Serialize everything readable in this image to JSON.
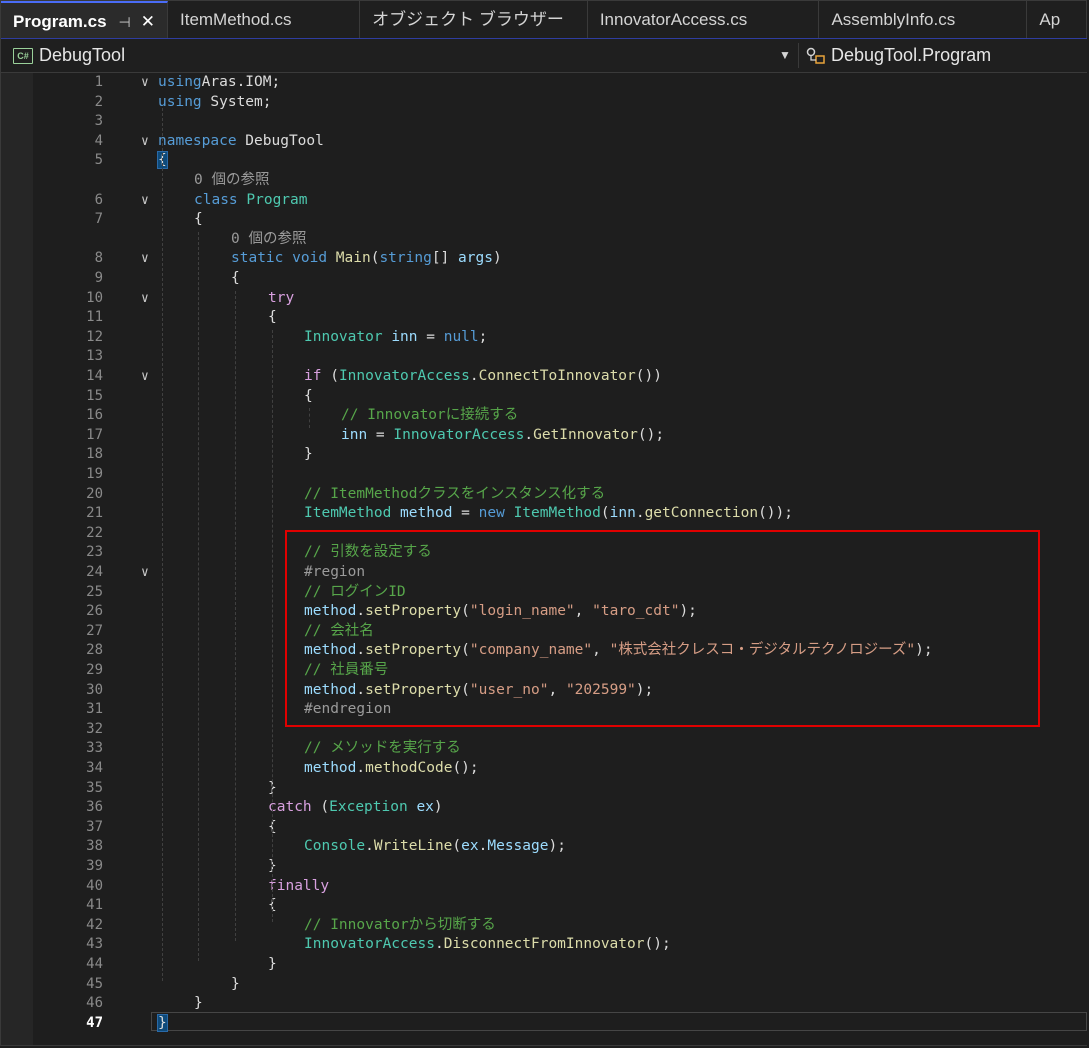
{
  "tabs": [
    {
      "label": "Program.cs",
      "active": true
    },
    {
      "label": "ItemMethod.cs",
      "active": false
    },
    {
      "label": "オブジェクト ブラウザー",
      "active": false
    },
    {
      "label": "InnovatorAccess.cs",
      "active": false
    },
    {
      "label": "AssemblyInfo.cs",
      "active": false
    },
    {
      "label": "Ap",
      "active": false
    }
  ],
  "navbar": {
    "project": "DebugTool",
    "project_badge": "C#",
    "class_path": "DebugTool.Program"
  },
  "icons": {
    "pin": "pin-icon",
    "close": "close-icon",
    "dropdown": "chevron-down-icon",
    "class": "class-icon",
    "fold": "fold-chevron-icon"
  },
  "colors": {
    "keyword": "#569cd6",
    "type": "#4ec9b0",
    "method": "#dcdcaa",
    "string": "#d69d85",
    "comment": "#57a64a",
    "highlight_box": "#e00000"
  },
  "code": {
    "highlighted_lines": "23-31",
    "current_line": 47,
    "lines": [
      {
        "n": 1,
        "fold": true,
        "indent": 0,
        "tokens": [
          [
            "kw",
            "using"
          ],
          [
            "",
            "Aras.IOM;"
          ]
        ]
      },
      {
        "n": 2,
        "fold": false,
        "indent": 0,
        "tokens": [
          [
            "kw",
            "using"
          ],
          [
            "",
            " System;"
          ]
        ]
      },
      {
        "n": 3,
        "fold": false,
        "indent": 0,
        "tokens": []
      },
      {
        "n": 4,
        "fold": true,
        "indent": 0,
        "tokens": [
          [
            "kw",
            "namespace"
          ],
          [
            "",
            " DebugTool"
          ]
        ]
      },
      {
        "n": 5,
        "fold": false,
        "indent": 0,
        "tokens": [
          [
            "brace",
            "{"
          ]
        ]
      },
      {
        "n": null,
        "ref": true,
        "indent": 1,
        "tokens": [
          [
            "ref",
            "0 個の参照"
          ]
        ]
      },
      {
        "n": 6,
        "fold": true,
        "indent": 1,
        "tokens": [
          [
            "kw",
            "class"
          ],
          [
            "",
            " "
          ],
          [
            "ty",
            "Program"
          ]
        ]
      },
      {
        "n": 7,
        "fold": false,
        "indent": 1,
        "tokens": [
          [
            "",
            "{"
          ]
        ]
      },
      {
        "n": null,
        "ref": true,
        "indent": 2,
        "tokens": [
          [
            "ref",
            "0 個の参照"
          ]
        ]
      },
      {
        "n": 8,
        "fold": true,
        "indent": 2,
        "tokens": [
          [
            "kw",
            "static"
          ],
          [
            "",
            " "
          ],
          [
            "kw",
            "void"
          ],
          [
            "",
            " "
          ],
          [
            "fn",
            "Main"
          ],
          [
            "",
            "("
          ],
          [
            "kw",
            "string"
          ],
          [
            "",
            "[] "
          ],
          [
            "var",
            "args"
          ],
          [
            "",
            ")"
          ]
        ]
      },
      {
        "n": 9,
        "fold": false,
        "indent": 2,
        "tokens": [
          [
            "",
            "{"
          ]
        ]
      },
      {
        "n": 10,
        "fold": true,
        "indent": 3,
        "tokens": [
          [
            "ctl",
            "try"
          ]
        ]
      },
      {
        "n": 11,
        "fold": false,
        "indent": 3,
        "tokens": [
          [
            "",
            "{"
          ]
        ]
      },
      {
        "n": 12,
        "fold": false,
        "indent": 4,
        "tokens": [
          [
            "ty",
            "Innovator"
          ],
          [
            "",
            " "
          ],
          [
            "var",
            "inn"
          ],
          [
            "",
            " = "
          ],
          [
            "kw",
            "null"
          ],
          [
            "",
            ";"
          ]
        ]
      },
      {
        "n": 13,
        "fold": false,
        "indent": 4,
        "tokens": []
      },
      {
        "n": 14,
        "fold": true,
        "indent": 4,
        "tokens": [
          [
            "ctl",
            "if"
          ],
          [
            "",
            " ("
          ],
          [
            "ty",
            "InnovatorAccess"
          ],
          [
            "",
            "."
          ],
          [
            "fn",
            "ConnectToInnovator"
          ],
          [
            "",
            "())"
          ]
        ]
      },
      {
        "n": 15,
        "fold": false,
        "indent": 4,
        "tokens": [
          [
            "",
            "{"
          ]
        ]
      },
      {
        "n": 16,
        "fold": false,
        "indent": 5,
        "tokens": [
          [
            "cm",
            "// Innovatorに接続する"
          ]
        ]
      },
      {
        "n": 17,
        "fold": false,
        "indent": 5,
        "tokens": [
          [
            "var",
            "inn"
          ],
          [
            "",
            " = "
          ],
          [
            "ty",
            "InnovatorAccess"
          ],
          [
            "",
            "."
          ],
          [
            "fn",
            "GetInnovator"
          ],
          [
            "",
            "();"
          ]
        ]
      },
      {
        "n": 18,
        "fold": false,
        "indent": 4,
        "tokens": [
          [
            "",
            "}"
          ]
        ]
      },
      {
        "n": 19,
        "fold": false,
        "indent": 4,
        "tokens": []
      },
      {
        "n": 20,
        "fold": false,
        "indent": 4,
        "tokens": [
          [
            "cm",
            "// ItemMethodクラスをインスタンス化する"
          ]
        ]
      },
      {
        "n": 21,
        "fold": false,
        "indent": 4,
        "tokens": [
          [
            "ty",
            "ItemMethod"
          ],
          [
            "",
            " "
          ],
          [
            "var",
            "method"
          ],
          [
            "",
            " = "
          ],
          [
            "kw",
            "new"
          ],
          [
            "",
            " "
          ],
          [
            "ty",
            "ItemMethod"
          ],
          [
            "",
            "("
          ],
          [
            "var",
            "inn"
          ],
          [
            "",
            "."
          ],
          [
            "fn",
            "getConnection"
          ],
          [
            "",
            "());"
          ]
        ]
      },
      {
        "n": 22,
        "fold": false,
        "indent": 4,
        "tokens": []
      },
      {
        "n": 23,
        "fold": false,
        "indent": 4,
        "tokens": [
          [
            "cm",
            "// 引数を設定する"
          ]
        ]
      },
      {
        "n": 24,
        "fold": true,
        "indent": 4,
        "tokens": [
          [
            "pp",
            "#region"
          ]
        ]
      },
      {
        "n": 25,
        "fold": false,
        "indent": 4,
        "tokens": [
          [
            "cm",
            "// ログインID"
          ]
        ]
      },
      {
        "n": 26,
        "fold": false,
        "indent": 4,
        "tokens": [
          [
            "var",
            "method"
          ],
          [
            "",
            "."
          ],
          [
            "fn",
            "setProperty"
          ],
          [
            "",
            "("
          ],
          [
            "str",
            "\"login_name\""
          ],
          [
            "",
            ", "
          ],
          [
            "str",
            "\"taro_cdt\""
          ],
          [
            "",
            ");"
          ]
        ]
      },
      {
        "n": 27,
        "fold": false,
        "indent": 4,
        "tokens": [
          [
            "cm",
            "// 会社名"
          ]
        ]
      },
      {
        "n": 28,
        "fold": false,
        "indent": 4,
        "tokens": [
          [
            "var",
            "method"
          ],
          [
            "",
            "."
          ],
          [
            "fn",
            "setProperty"
          ],
          [
            "",
            "("
          ],
          [
            "str",
            "\"company_name\""
          ],
          [
            "",
            ", "
          ],
          [
            "str",
            "\"株式会社クレスコ・デジタルテクノロジーズ\""
          ],
          [
            "",
            ");"
          ]
        ]
      },
      {
        "n": 29,
        "fold": false,
        "indent": 4,
        "tokens": [
          [
            "cm",
            "// 社員番号"
          ]
        ]
      },
      {
        "n": 30,
        "fold": false,
        "indent": 4,
        "tokens": [
          [
            "var",
            "method"
          ],
          [
            "",
            "."
          ],
          [
            "fn",
            "setProperty"
          ],
          [
            "",
            "("
          ],
          [
            "str",
            "\"user_no\""
          ],
          [
            "",
            ", "
          ],
          [
            "str",
            "\"202599\""
          ],
          [
            "",
            ");"
          ]
        ]
      },
      {
        "n": 31,
        "fold": false,
        "indent": 4,
        "tokens": [
          [
            "pp",
            "#endregion"
          ]
        ]
      },
      {
        "n": 32,
        "fold": false,
        "indent": 4,
        "tokens": []
      },
      {
        "n": 33,
        "fold": false,
        "indent": 4,
        "tokens": [
          [
            "cm",
            "// メソッドを実行する"
          ]
        ]
      },
      {
        "n": 34,
        "fold": false,
        "indent": 4,
        "tokens": [
          [
            "var",
            "method"
          ],
          [
            "",
            "."
          ],
          [
            "fn",
            "methodCode"
          ],
          [
            "",
            "();"
          ]
        ]
      },
      {
        "n": 35,
        "fold": false,
        "indent": 3,
        "tokens": [
          [
            "",
            "}"
          ]
        ]
      },
      {
        "n": 36,
        "fold": false,
        "indent": 3,
        "tokens": [
          [
            "ctl",
            "catch"
          ],
          [
            "",
            " ("
          ],
          [
            "ty",
            "Exception"
          ],
          [
            "",
            " "
          ],
          [
            "var",
            "ex"
          ],
          [
            "",
            ")"
          ]
        ]
      },
      {
        "n": 37,
        "fold": false,
        "indent": 3,
        "tokens": [
          [
            "",
            "{"
          ]
        ]
      },
      {
        "n": 38,
        "fold": false,
        "indent": 4,
        "tokens": [
          [
            "ty",
            "Console"
          ],
          [
            "",
            "."
          ],
          [
            "fn",
            "WriteLine"
          ],
          [
            "",
            "("
          ],
          [
            "var",
            "ex"
          ],
          [
            "",
            "."
          ],
          [
            "var",
            "Message"
          ],
          [
            "",
            ");"
          ]
        ]
      },
      {
        "n": 39,
        "fold": false,
        "indent": 3,
        "tokens": [
          [
            "",
            "}"
          ]
        ]
      },
      {
        "n": 40,
        "fold": false,
        "indent": 3,
        "tokens": [
          [
            "ctl",
            "finally"
          ]
        ]
      },
      {
        "n": 41,
        "fold": false,
        "indent": 3,
        "tokens": [
          [
            "",
            "{"
          ]
        ]
      },
      {
        "n": 42,
        "fold": false,
        "indent": 4,
        "tokens": [
          [
            "cm",
            "// Innovatorから切断する"
          ]
        ]
      },
      {
        "n": 43,
        "fold": false,
        "indent": 4,
        "tokens": [
          [
            "ty",
            "InnovatorAccess"
          ],
          [
            "",
            "."
          ],
          [
            "fn",
            "DisconnectFromInnovator"
          ],
          [
            "",
            "();"
          ]
        ]
      },
      {
        "n": 44,
        "fold": false,
        "indent": 3,
        "tokens": [
          [
            "",
            "}"
          ]
        ]
      },
      {
        "n": 45,
        "fold": false,
        "indent": 2,
        "tokens": [
          [
            "",
            "}"
          ]
        ]
      },
      {
        "n": 46,
        "fold": false,
        "indent": 1,
        "tokens": [
          [
            "",
            "}"
          ]
        ]
      },
      {
        "n": 47,
        "fold": false,
        "indent": 0,
        "tokens": [
          [
            "brace",
            "}"
          ]
        ]
      }
    ]
  }
}
